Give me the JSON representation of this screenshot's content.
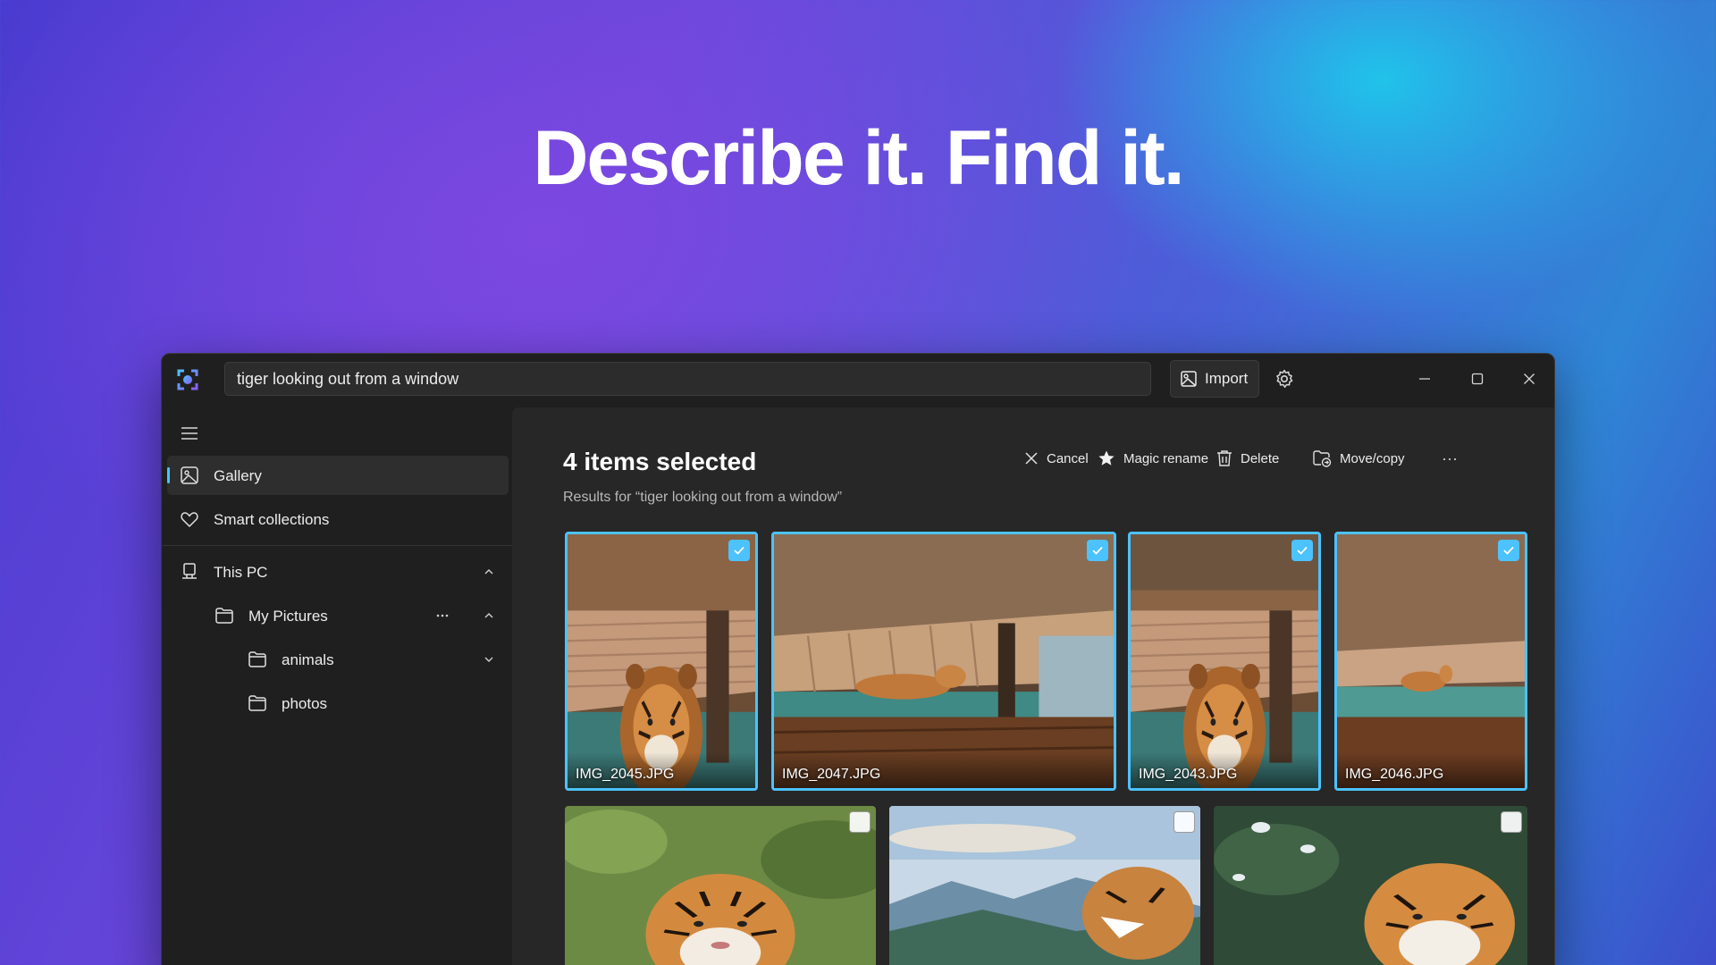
{
  "headline": "Describe it. Find it.",
  "search": {
    "value": "tiger looking out from a window"
  },
  "toolbar": {
    "import_label": "Import"
  },
  "sidebar": {
    "gallery": "Gallery",
    "smart_collections": "Smart collections",
    "this_pc": "This PC",
    "my_pictures": "My Pictures",
    "animals": "animals",
    "photos": "photos"
  },
  "content": {
    "title": "4 items selected",
    "results": "Results for “tiger looking out from a window”",
    "commands": {
      "cancel": "Cancel",
      "magic_rename": "Magic rename",
      "delete": "Delete",
      "move_copy": "Move/copy",
      "more": "···"
    },
    "selected_photos": [
      "IMG_2045.JPG",
      "IMG_2047.JPG",
      "IMG_2043.JPG",
      "IMG_2046.JPG"
    ],
    "accent_color": "#4cc2ff"
  }
}
